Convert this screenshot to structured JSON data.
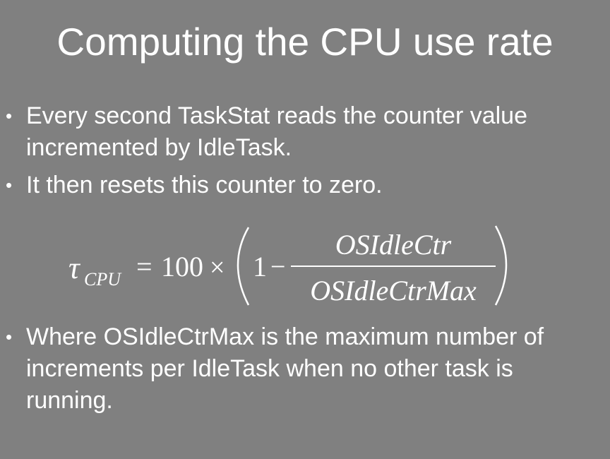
{
  "slide": {
    "title": "Computing the CPU use rate",
    "bullets_top": [
      "Every second TaskStat reads the counter value incremented by IdleTask.",
      "It then resets this counter to zero."
    ],
    "bullets_bottom": [
      "Where OSIdleCtrMax is the maximum number of increments per IdleTask when no other task is running."
    ],
    "bullet_symbol": "•"
  },
  "formula": {
    "symbol": "τ",
    "subscript": "CPU",
    "equals": "=",
    "factor": "100",
    "times": "×",
    "one": "1",
    "minus": "−",
    "numerator": "OSIdleCtr",
    "denominator": "OSIdleCtrMax"
  }
}
